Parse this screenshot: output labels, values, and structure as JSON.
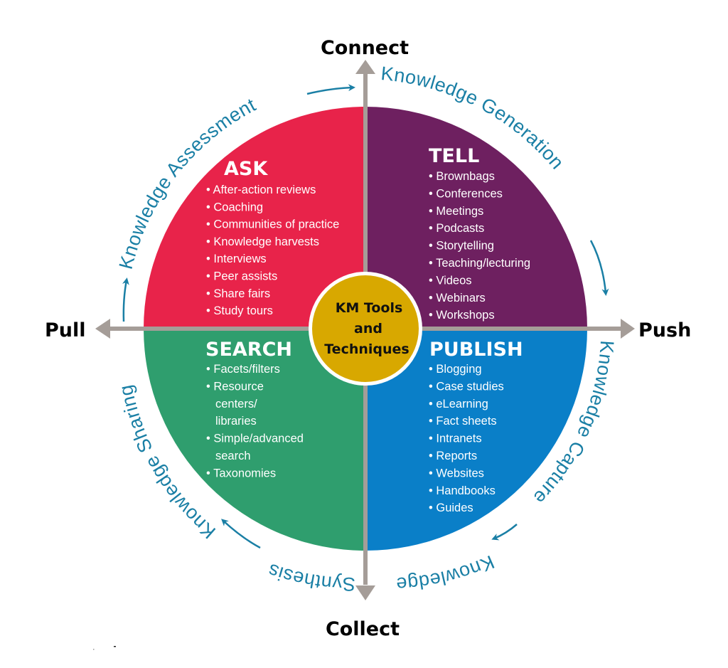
{
  "colors": {
    "ask": "#e8234a",
    "tell": "#6e2060",
    "search": "#2f9e6e",
    "publish": "#0a7fc8",
    "center": "#d8a800",
    "axis": "#a59d98",
    "arc_text": "#1a7fa5"
  },
  "axes": {
    "top": "Connect",
    "bottom": "Collect",
    "left": "Pull",
    "right": "Push"
  },
  "center": {
    "line1": "KM Tools",
    "line2": "and",
    "line3": "Techniques"
  },
  "quadrants": {
    "ask": {
      "title": "ASK",
      "items": [
        "• After-action reviews",
        "• Coaching",
        "• Communities of practice",
        "• Knowledge harvests",
        "• Interviews",
        "• Peer assists",
        "• Share fairs",
        "• Study tours"
      ]
    },
    "tell": {
      "title": "TELL",
      "items": [
        "• Brownbags",
        "• Conferences",
        "• Meetings",
        "• Podcasts",
        "• Storytelling",
        "• Teaching/lecturing",
        "• Videos",
        "• Webinars",
        "• Workshops"
      ]
    },
    "search": {
      "title": "SEARCH",
      "items": [
        "• Facets/filters",
        "• Resource",
        "centers/",
        "libraries",
        "• Simple/advanced",
        "search",
        "• Taxonomies"
      ]
    },
    "publish": {
      "title": "PUBLISH",
      "items": [
        "• Blogging",
        "• Case studies",
        "• eLearning",
        "• Fact sheets",
        "• Intranets",
        "• Reports",
        "• Websites",
        "• Handbooks",
        "• Guides"
      ]
    }
  },
  "cycle": {
    "assessment": "Knowledge Assessment",
    "generation": "Knowledge Generation",
    "capture": "Knowledge Capture",
    "synthesis": "Knowledge Synthesis",
    "synthesis_part1": "Knowledge",
    "synthesis_part2": "Synthesis",
    "sharing": "Knowledge Sharing"
  }
}
